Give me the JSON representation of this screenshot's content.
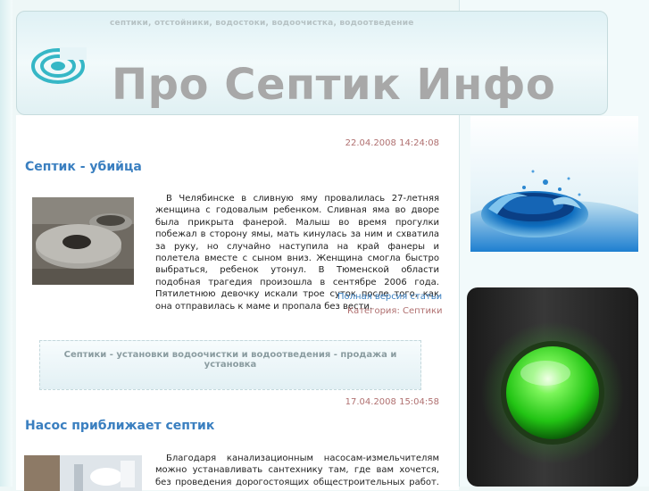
{
  "header": {
    "tagline": "септики, отстойники, водостоки, водоочистка, водоотведение",
    "title": "Про Септик Инфо"
  },
  "articles": [
    {
      "date": "22.04.2008 14:24:08",
      "title": "Септик - убийца",
      "text": "В Челябинске в сливную яму провалилась 27-летняя женщина с годовалым ребенком. Сливная яма во дворе была прикрыта фанерой. Малыш во время прогулки побежал в сторону ямы, мать кинулась за ним и схватила за руку, но случайно наступила на край фанеры и полетела вместе с сыном вниз. Женщина смогла быстро выбраться, ребенок утонул. В Тюменской области подобная трагедия произошла в сентябре 2006 года. Пятилетнюю девочку искали трое суток после того, как она отправилась к маме и пропала без вести.",
      "full_link": "Полная версия статьи",
      "category_label": "Категория:",
      "category_value": "Септики"
    },
    {
      "date": "17.04.2008 15:04:58",
      "title": "Насос приближает септик",
      "text": "Благодаря канализационным насосам-измельчителям можно устанавливать сантехнику там, где вам хочется, без проведения дорогостоящих общестроительных работ. В зависимости от модели эти агрегаты используют отходы и откачивают использованную"
    }
  ],
  "banner": {
    "text": "Септики - установки водоочистки и водоотведения - продажа и установка"
  },
  "colors": {
    "title_blue": "#3a7fc0",
    "date_red": "#b07070",
    "header_title_gray": "#a8a8a8",
    "button_green": "#3ddc2a"
  },
  "icons": {
    "logo": "spiral-logo-icon",
    "water": "water-splash-image",
    "button": "green-round-button-image"
  }
}
